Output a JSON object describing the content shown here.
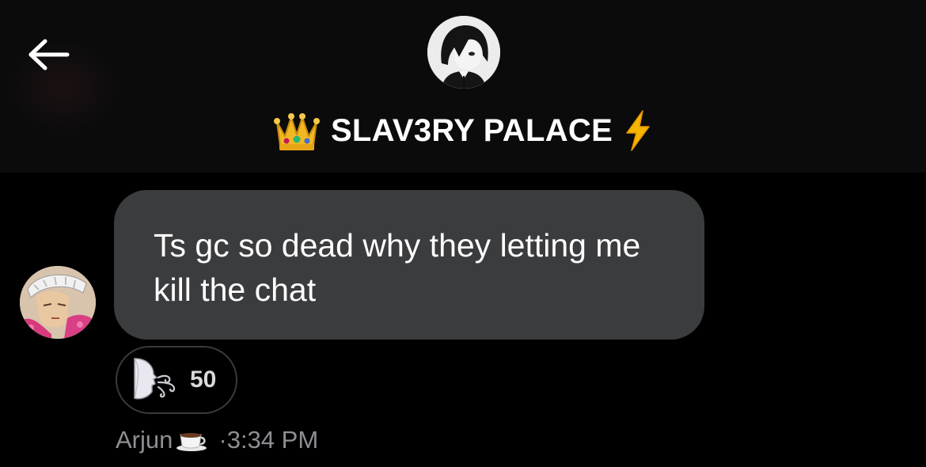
{
  "header": {
    "group_name": "SLAV3RY PALACE",
    "title_prefix_icon": "crown-emoji",
    "title_suffix_icon": "lightning-emoji",
    "back_icon": "arrow-left-icon"
  },
  "message": {
    "text": "Ts gc so dead why they letting me kill the chat",
    "reaction": {
      "icon": "blowing-face-emoji",
      "count": "50"
    },
    "sender": "Arjun",
    "sender_suffix_icon": "coffee-emoji",
    "time": "·3:34 PM"
  },
  "colors": {
    "background": "#000000",
    "header_background": "#0b0b0c",
    "bubble": "#3b3c3e",
    "meta_text": "#8e8e93",
    "pill_border": "#3a3a3c",
    "lightning": "#f5b400"
  }
}
